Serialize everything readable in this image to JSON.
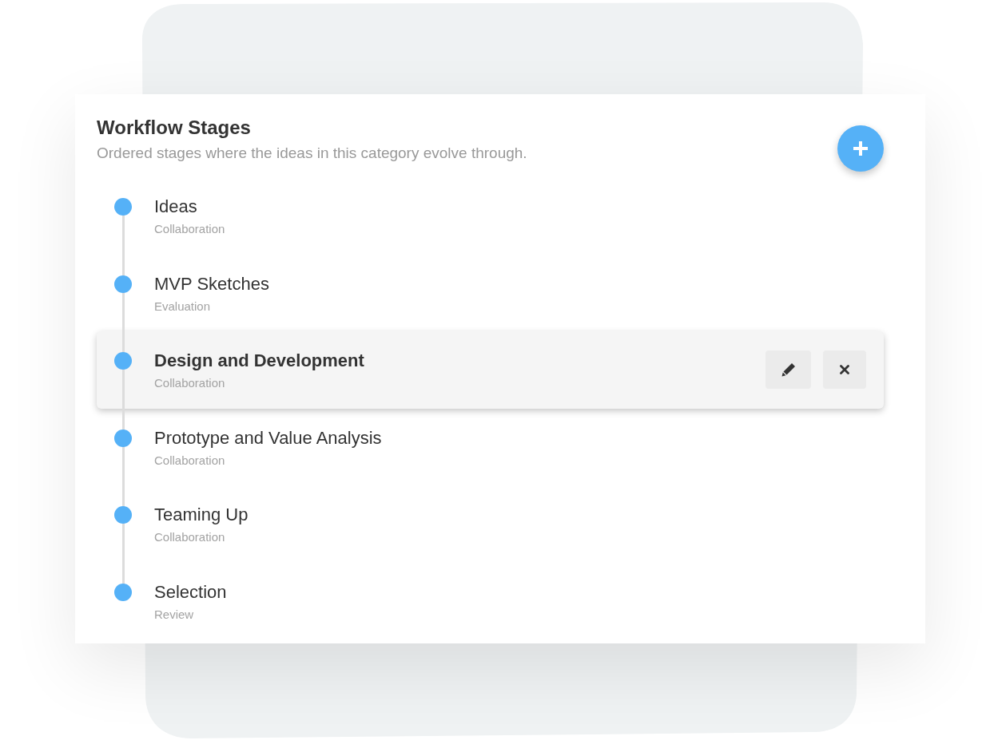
{
  "header": {
    "title": "Workflow Stages",
    "subtitle": "Ordered stages where the ideas in this category evolve through."
  },
  "stages": [
    {
      "name": "Ideas",
      "type": "Collaboration",
      "selected": false
    },
    {
      "name": "MVP Sketches",
      "type": "Evaluation",
      "selected": false
    },
    {
      "name": "Design and Development",
      "type": "Collaboration",
      "selected": true
    },
    {
      "name": "Prototype and Value Analysis",
      "type": "Collaboration",
      "selected": false
    },
    {
      "name": "Teaming Up",
      "type": "Collaboration",
      "selected": false
    },
    {
      "name": "Selection",
      "type": "Review",
      "selected": false
    }
  ]
}
